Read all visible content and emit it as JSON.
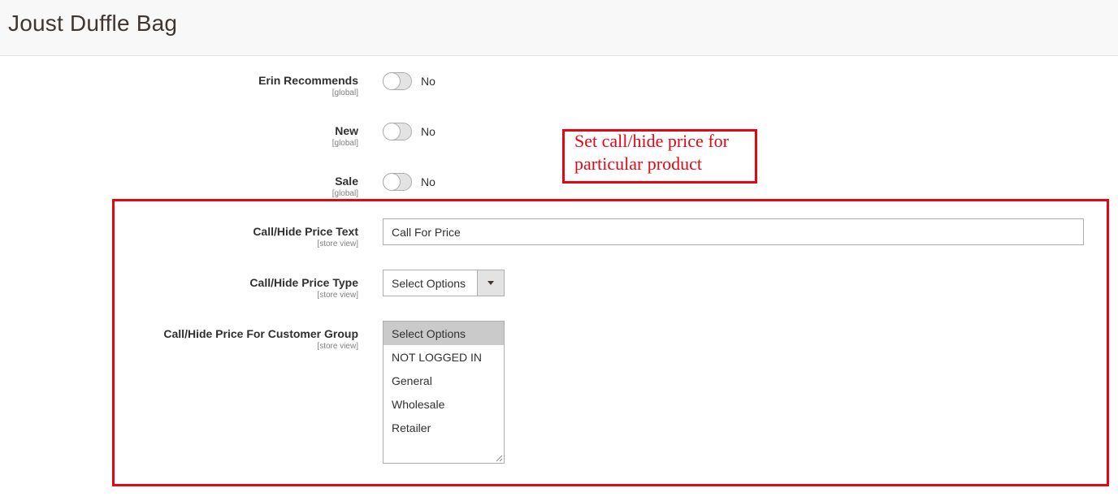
{
  "page": {
    "title": "Joust Duffle Bag"
  },
  "toggles": [
    {
      "label": "Erin Recommends",
      "scope": "[global]",
      "value": "No",
      "checked": false
    },
    {
      "label": "New",
      "scope": "[global]",
      "value": "No",
      "checked": false
    },
    {
      "label": "Sale",
      "scope": "[global]",
      "value": "No",
      "checked": false
    }
  ],
  "call_hide_price_text": {
    "label": "Call/Hide Price Text",
    "scope": "[store view]",
    "value": "Call For Price"
  },
  "call_hide_price_type": {
    "label": "Call/Hide Price Type",
    "scope": "[store view]",
    "selected": "Select Options"
  },
  "call_hide_price_customer_group": {
    "label": "Call/Hide Price For Customer Group",
    "scope": "[store view]",
    "options": [
      "Select Options",
      "NOT LOGGED IN",
      "General",
      "Wholesale",
      "Retailer"
    ],
    "selected_index": 0
  },
  "annotation": {
    "text": "Set call/hide price for particular product"
  },
  "colors": {
    "annotation": "#e30613",
    "header_bg": "#f8f8f8",
    "selected_option_bg": "#cacaca"
  }
}
